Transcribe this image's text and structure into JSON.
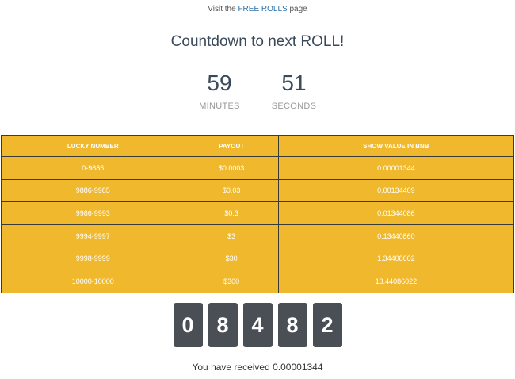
{
  "visit": {
    "prefix": "Visit the",
    "link_text": "FREE ROLLS",
    "suffix": "page"
  },
  "countdown": {
    "title": "Countdown to next ROLL!",
    "minutes": "59",
    "minutes_label": "MINUTES",
    "seconds": "51",
    "seconds_label": "SECONDS"
  },
  "payout_table": {
    "headers": [
      "LUCKY NUMBER",
      "PAYOUT",
      "SHOW VALUE IN BNB"
    ],
    "rows": [
      [
        "0-9885",
        "$0.0003",
        "0.00001344"
      ],
      [
        "9886-9985",
        "$0.03",
        "0.00134409"
      ],
      [
        "9986-9993",
        "$0.3",
        "0.01344086"
      ],
      [
        "9994-9997",
        "$3",
        "0.13440860"
      ],
      [
        "9998-9999",
        "$30",
        "1.34408602"
      ],
      [
        "10000-10000",
        "$300",
        "13.44086022"
      ]
    ],
    "background_color": "#f0b82d"
  },
  "roll_digits": [
    "0",
    "8",
    "4",
    "8",
    "2"
  ],
  "received_text": "You have received 0.00001344"
}
